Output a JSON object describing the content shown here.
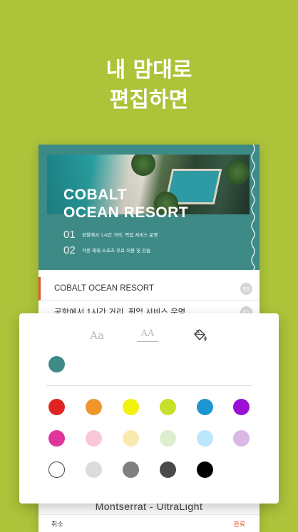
{
  "headline": {
    "line1": "내 맘대로",
    "line2": "편집하면"
  },
  "hero": {
    "title_line1": "COBALT",
    "title_line2": "OCEAN RESORT",
    "items": [
      {
        "num": "01",
        "text": "공항에서 1시간 거리, 픽업 서비스 운영"
      },
      {
        "num": "02",
        "text": "각종 해제 스포츠 무료 이용 및 강습"
      }
    ],
    "bg_color": "#3e8a86"
  },
  "fields": [
    {
      "text": "COBALT OCEAN RESORT"
    },
    {
      "text": "공항에서 1시간 거리, 픽업 서비스 운영"
    }
  ],
  "edit_badge_label": "편집",
  "font_name": "Montserrat - UltraLight",
  "bottom_bar": {
    "cancel": "취소",
    "done": "완료"
  },
  "panel": {
    "tabs": [
      {
        "name": "font",
        "label": "Aa"
      },
      {
        "name": "size",
        "label": "AA"
      },
      {
        "name": "color",
        "icon": "paint-bucket-icon"
      }
    ],
    "active_tab": "color",
    "selected_color": "#3e8a86",
    "swatches": [
      [
        "#e02424",
        "#f0952a",
        "#f2f20a",
        "#c8e02a",
        "#1d95d2",
        "#9c0fd6"
      ],
      [
        "#e0359a",
        "#f9c8d6",
        "#fbeab0",
        "#dcefcf",
        "#bce6fb",
        "#d9b8e6"
      ],
      [
        "#ffffff",
        "#dcdcdc",
        "#808080",
        "#4a4a4a",
        "#000000"
      ]
    ]
  },
  "colors": {
    "background": "#adc33a",
    "accent": "#e8542a"
  }
}
